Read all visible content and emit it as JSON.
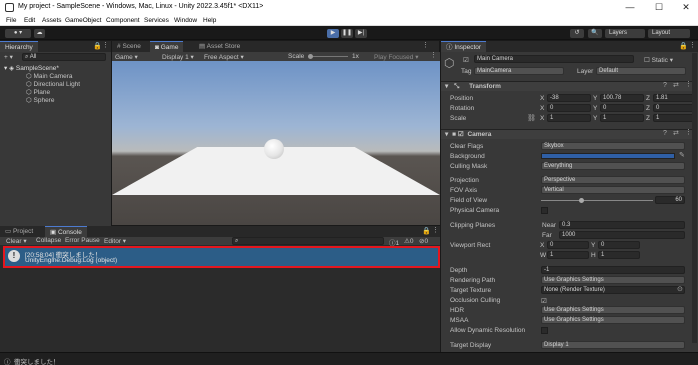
{
  "window": {
    "title": "My project - SampleScene - Windows, Mac, Linux - Unity 2022.3.45f1* <DX11>",
    "minimize": "—",
    "maximize": "☐",
    "close": "✕"
  },
  "menu": [
    "File",
    "Edit",
    "Assets",
    "GameObject",
    "Component",
    "Services",
    "Window",
    "Help"
  ],
  "toolbar": {
    "account": "●  ▾",
    "cloud": "☁",
    "play": "▶",
    "pause": "❚❚",
    "step": "▶|",
    "history": "↺",
    "search": "🔍",
    "layers": "Layers",
    "layout": "Layout"
  },
  "hierarchy": {
    "tab": "Hierarchy",
    "add": "+ ▾",
    "search_placeholder": "All",
    "scene": "SampleScene*",
    "items": [
      "Main Camera",
      "Directional Light",
      "Plane",
      "Sphere"
    ]
  },
  "center_tabs": [
    "Scene",
    "Game",
    "Asset Store"
  ],
  "game_bar": {
    "mode": "Game",
    "display": "Display 1",
    "aspect": "Free Aspect",
    "scale_label": "Scale",
    "scale_value": "1x",
    "play_focused": "Play Focused"
  },
  "bottom_tabs": [
    "Project",
    "Console"
  ],
  "console": {
    "clear": "Clear",
    "collapse": "Collapse",
    "error_pause": "Error Pause",
    "editor": "Editor",
    "count_info": "1",
    "count_warn": "0",
    "count_error": "0",
    "entry_line1": "[20:58:04] 衝突しました！",
    "entry_line2": "UnityEngine.Debug:Log (object)"
  },
  "status_bar": {
    "message": "衝突しました！"
  },
  "inspector": {
    "tab": "Inspector",
    "object_name": "Main Camera",
    "static_label": "Static",
    "tag_label": "Tag",
    "tag_value": "MainCamera",
    "layer_label": "Layer",
    "layer_value": "Default",
    "transform": {
      "title": "Transform",
      "position_label": "Position",
      "position": [
        "-38",
        "100.78",
        "1.81"
      ],
      "rotation_label": "Rotation",
      "rotation": [
        "0",
        "0",
        "0"
      ],
      "scale_label": "Scale",
      "scale": [
        "1",
        "1",
        "1"
      ]
    },
    "camera": {
      "title": "Camera",
      "clear_flags": [
        "Clear Flags",
        "Skybox"
      ],
      "background": "Background",
      "background_color": "#2f5fa5",
      "culling_mask": [
        "Culling Mask",
        "Everything"
      ],
      "projection": [
        "Projection",
        "Perspective"
      ],
      "fov_axis": [
        "FOV Axis",
        "Vertical"
      ],
      "field_of_view": [
        "Field of View",
        "60"
      ],
      "physical_camera": "Physical Camera",
      "clipping_planes": "Clipping Planes",
      "near": [
        "Near",
        "0.3"
      ],
      "far": [
        "Far",
        "1000"
      ],
      "viewport_rect": "Viewport Rect",
      "vx": "0",
      "vy": "0",
      "vw": "1",
      "vh": "1",
      "depth": [
        "Depth",
        "-1"
      ],
      "rendering_path": [
        "Rendering Path",
        "Use Graphics Settings"
      ],
      "target_texture": [
        "Target Texture",
        "None (Render Texture)"
      ],
      "occlusion_culling": "Occlusion Culling",
      "hdr": [
        "HDR",
        "Use Graphics Settings"
      ],
      "msaa": [
        "MSAA",
        "Use Graphics Settings"
      ],
      "allow_dynamic": "Allow Dynamic Resolution",
      "target_display": [
        "Target Display",
        "Display 1"
      ]
    }
  }
}
